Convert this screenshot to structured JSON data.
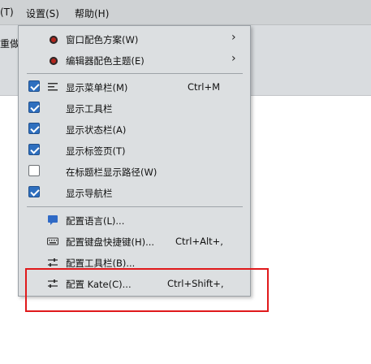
{
  "menubar": {
    "partial_label": "(T)",
    "settings": "设置(S)",
    "help": "帮助(H)"
  },
  "toolbar": {
    "partial_text": "重做"
  },
  "settings_menu": {
    "window_color_scheme": "窗口配色方案(W)",
    "editor_color_theme": "编辑器配色主题(E)",
    "show_menubar": {
      "label": "显示菜单栏(M)",
      "shortcut": "Ctrl+M",
      "checked": true
    },
    "show_toolbar": {
      "label": "显示工具栏",
      "checked": true
    },
    "show_statusbar": {
      "label": "显示状态栏(A)",
      "checked": true
    },
    "show_tabs": {
      "label": "显示标签页(T)",
      "checked": true
    },
    "show_path": {
      "label": "在标题栏显示路径(W)",
      "checked": false
    },
    "show_navbar": {
      "label": "显示导航栏",
      "checked": true
    },
    "configure_language": "配置语言(L)...",
    "configure_shortcuts": {
      "label": "配置键盘快捷键(H)...",
      "shortcut": "Ctrl+Alt+,"
    },
    "configure_toolbars": "配置工具栏(B)...",
    "configure_kate": {
      "label": "配置 Kate(C)...",
      "shortcut": "Ctrl+Shift+,"
    }
  },
  "colors": {
    "highlight_border": "#e0191b",
    "checkbox_checked": "#2e6fbf",
    "menu_background": "#dcdfe1"
  }
}
